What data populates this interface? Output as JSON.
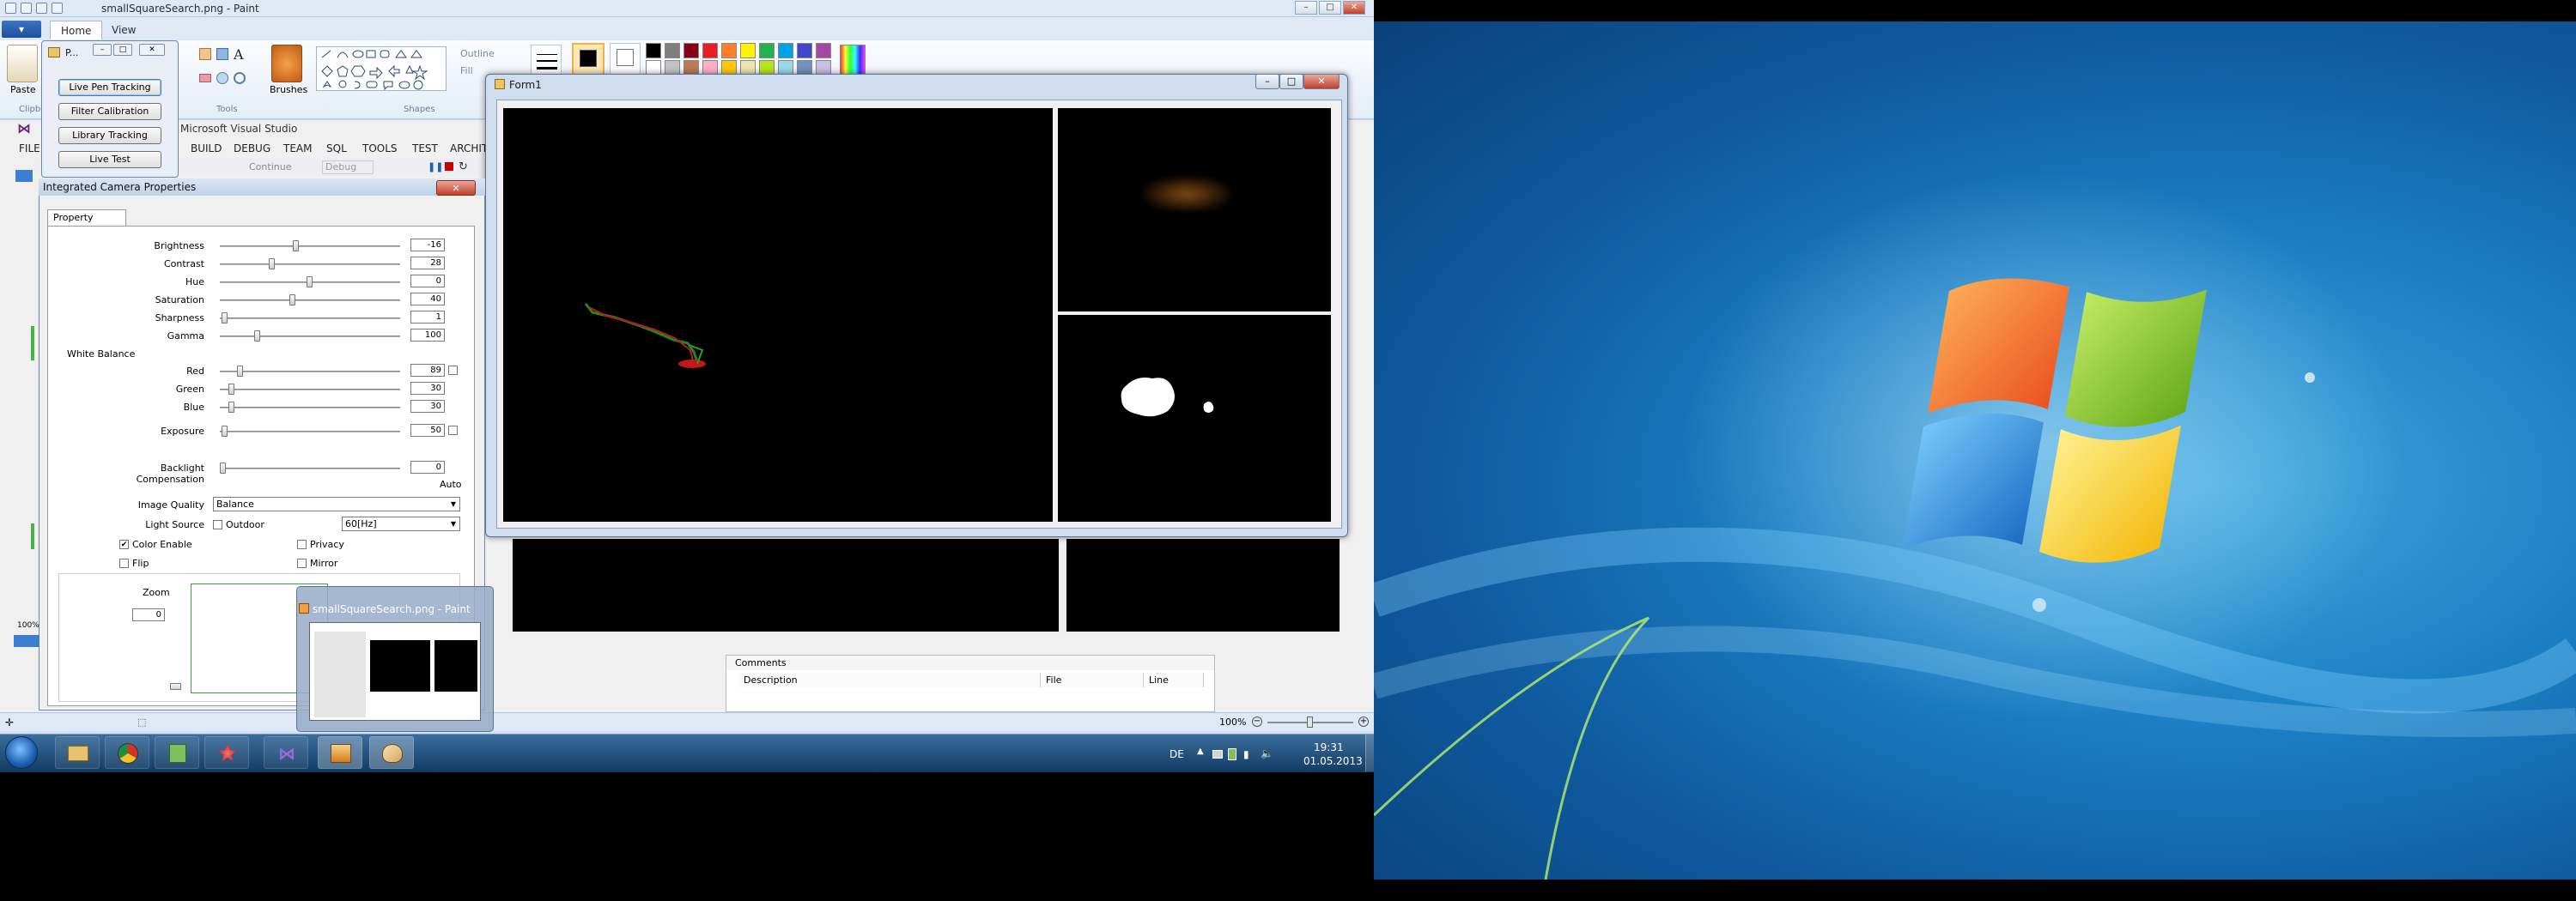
{
  "paint": {
    "window_title": "smallSquareSearch.png - Paint",
    "tabs": [
      "Home",
      "View"
    ],
    "groups": {
      "clipboard": "Clipboard",
      "tools": "Tools",
      "shapes": "Shapes"
    },
    "paste_label": "Paste",
    "brushes_label": "Brushes",
    "outline_label": "Outline",
    "fill_label": "Fill",
    "zoom_text": "100%",
    "status_left_zoom": "100%",
    "palette": [
      "#000000",
      "#7f7f7f",
      "#880015",
      "#ed1c24",
      "#ff7f27",
      "#fff200",
      "#22b14c",
      "#00a2e8",
      "#3f48cc",
      "#a349a4",
      "#ffffff",
      "#c3c3c3",
      "#b97a57",
      "#ffaec9",
      "#ffc90e",
      "#efe4b0",
      "#b5e61d",
      "#99d9ea",
      "#7092be",
      "#c8bfe7"
    ]
  },
  "tracking_window": {
    "title": "P...",
    "buttons": [
      "Live Pen Tracking",
      "Filter Calibration",
      "Library Tracking",
      "Live Test"
    ]
  },
  "vs": {
    "title": "Microsoft Visual Studio",
    "menu": [
      "FILE",
      "BUILD",
      "DEBUG",
      "TEAM",
      "SQL",
      "TOOLS",
      "TEST",
      "ARCHIT"
    ],
    "continue_label": "Continue",
    "debug_label": "Debug",
    "comments": {
      "header": "Comments",
      "columns": [
        "Description",
        "File",
        "Line"
      ]
    }
  },
  "form1": {
    "title": "Form1"
  },
  "camera_dialog": {
    "title": "Integrated Camera Properties",
    "tab": "Property settings",
    "sliders": [
      {
        "label": "Brightness",
        "value": "-16",
        "level": 0.42
      },
      {
        "label": "Contrast",
        "value": "28",
        "level": 0.28
      },
      {
        "label": "Hue",
        "value": "0",
        "level": 0.5
      },
      {
        "label": "Saturation",
        "value": "40",
        "level": 0.4
      },
      {
        "label": "Sharpness",
        "value": "1",
        "level": 0.01
      },
      {
        "label": "Gamma",
        "value": "100",
        "level": 0.2
      }
    ],
    "white_balance_label": "White Balance",
    "wb_sliders": [
      {
        "label": "Red",
        "value": "89",
        "level": 0.1
      },
      {
        "label": "Green",
        "value": "30",
        "level": 0.05
      },
      {
        "label": "Blue",
        "value": "30",
        "level": 0.05
      }
    ],
    "exposure": {
      "label": "Exposure",
      "value": "50",
      "level": 0.01
    },
    "backlight": {
      "label": "Backlight Compensation",
      "value": "0",
      "level": 0.0
    },
    "auto_label": "Auto",
    "image_quality": {
      "label": "Image Quality",
      "value": "Balance"
    },
    "light_source": {
      "label": "Light Source",
      "outdoor": "Outdoor",
      "value": "60[Hz]"
    },
    "checkboxes": {
      "color_enable": "Color Enable",
      "privacy": "Privacy",
      "flip": "Flip",
      "mirror": "Mirror"
    },
    "zoom": {
      "label": "Zoom",
      "value": "0"
    }
  },
  "taskbar_preview": {
    "title": "smallSquareSearch.png - Paint"
  },
  "tray": {
    "language": "DE",
    "time": "19:31",
    "date": "01.05.2013"
  }
}
